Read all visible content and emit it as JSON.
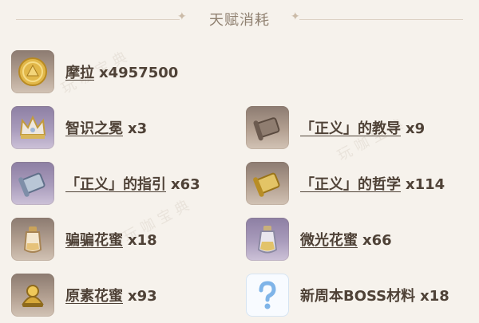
{
  "header": {
    "title": "天赋消耗"
  },
  "items": [
    {
      "name": "摩拉",
      "qty": "x4957500",
      "icon": "mora-coin-icon",
      "underline": true
    },
    {
      "name": "智识之冕",
      "qty": "x3",
      "icon": "crown-icon",
      "underline": true
    },
    {
      "name": "「正义」的教导",
      "qty": "x9",
      "icon": "scroll-icon",
      "underline": true
    },
    {
      "name": "「正义」的指引",
      "qty": "x63",
      "icon": "scroll-icon",
      "underline": true
    },
    {
      "name": "「正义」的哲学",
      "qty": "x114",
      "icon": "golden-scroll-icon",
      "underline": true
    },
    {
      "name": "骗骗花蜜",
      "qty": "x18",
      "icon": "nectar-bottle-icon",
      "underline": true
    },
    {
      "name": "微光花蜜",
      "qty": "x66",
      "icon": "shimmer-nectar-icon",
      "underline": true
    },
    {
      "name": "原素花蜜",
      "qty": "x93",
      "icon": "energy-nectar-icon",
      "underline": true
    },
    {
      "name": "新周本BOSS材料",
      "qty": "x18",
      "icon": "question-mark-icon",
      "underline": false
    }
  ],
  "watermark": "玩咖宝典",
  "colors": {
    "background": "#f6f2ec",
    "text": "#4f4237",
    "title": "#8f8070"
  }
}
